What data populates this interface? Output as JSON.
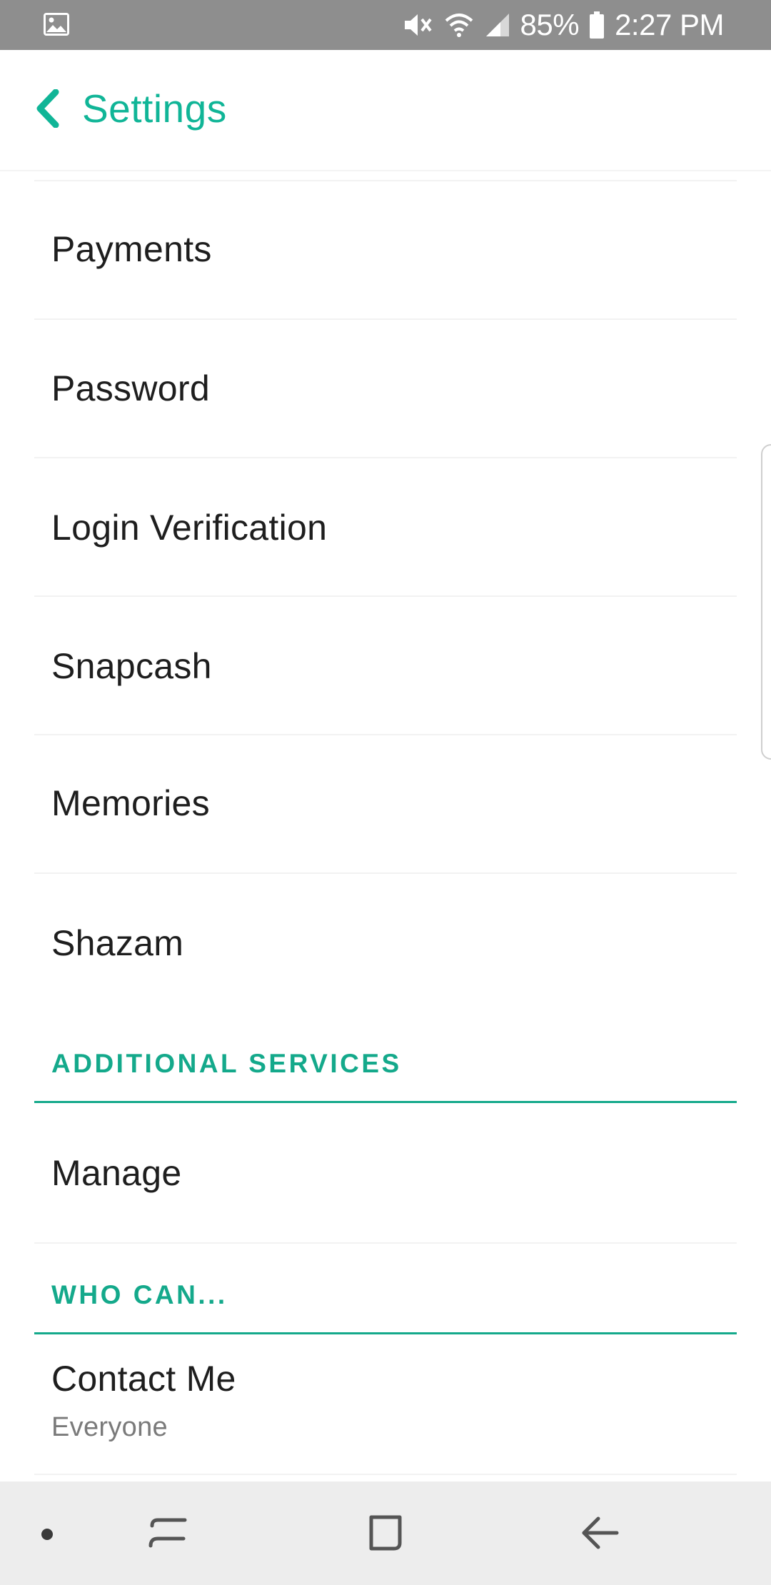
{
  "status_bar": {
    "battery": "85%",
    "time": "2:27 PM",
    "icons": [
      "image-icon",
      "mute-icon",
      "wifi-icon",
      "signal-icon",
      "battery-icon"
    ]
  },
  "header": {
    "title": "Settings",
    "back_icon": "chevron-left-icon",
    "accent_color": "#10b597"
  },
  "items": {
    "payments": "Payments",
    "password": "Password",
    "login_verification": "Login Verification",
    "snapcash": "Snapcash",
    "memories": "Memories",
    "shazam": "Shazam",
    "manage": "Manage",
    "contact_me": "Contact Me",
    "contact_me_value": "Everyone"
  },
  "sections": {
    "additional_services": "ADDITIONAL SERVICES",
    "who_can": "WHO CAN..."
  },
  "nav_bar": {
    "icons": [
      "dot-icon",
      "recents-icon",
      "home-icon",
      "back-icon"
    ]
  }
}
